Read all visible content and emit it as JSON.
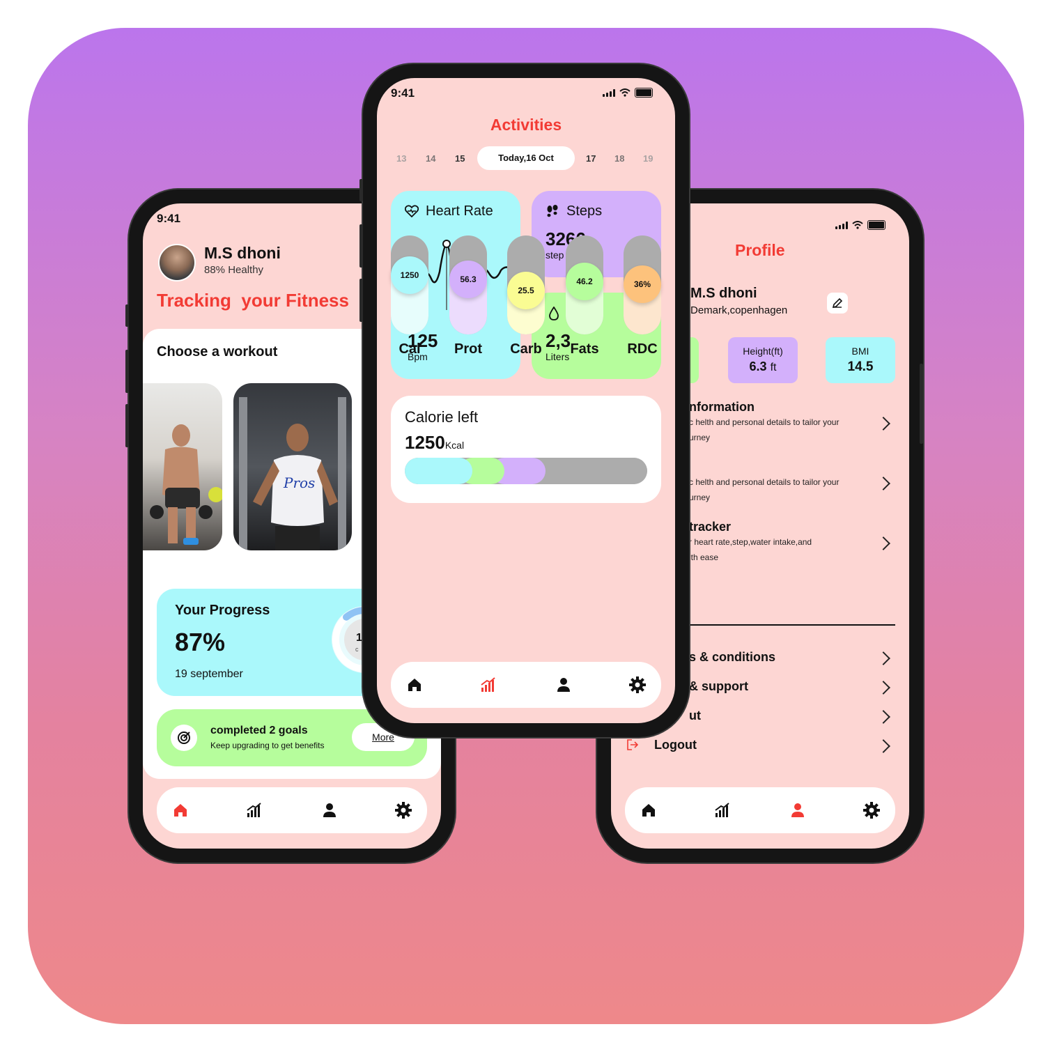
{
  "colors": {
    "accent_red": "#f23b34",
    "screen_bg": "#fdd6d3",
    "cyan": "#aaf8fb",
    "purple": "#d3b0fb",
    "green": "#b6fd9c",
    "yellow": "#fafc93",
    "orange": "#fdc27c",
    "gray": "#acacac"
  },
  "left_phone": {
    "time": "9:41",
    "user_name": "M.S dhoni",
    "health": "88% Healthy",
    "headline": "Tracking  your Fitness",
    "choose_title": "Choose a workout",
    "progress": {
      "title": "Your Progress",
      "percent": "87%",
      "date": "19 september",
      "ring_text": "1",
      "ring_sub": "c",
      "ring_fraction": 0.87
    },
    "goals": {
      "title": "completed 2 goals",
      "subtitle": "Keep upgrading to get benefits",
      "more": "More"
    },
    "nav": {
      "active": "home",
      "icons": [
        "home-icon",
        "stats-icon",
        "profile-icon",
        "settings-icon"
      ]
    }
  },
  "center_phone": {
    "time": "9:41",
    "title": "Activities",
    "dates": [
      "13",
      "14",
      "15",
      "Today,16 Oct",
      "17",
      "18",
      "19"
    ],
    "heart_rate": {
      "label": "Heart Rate",
      "value": "125",
      "unit": "Bpm"
    },
    "steps": {
      "label": "Steps",
      "value": "3266",
      "unit": "step"
    },
    "water": {
      "label": "water",
      "value": "2,3",
      "unit": "Liters"
    },
    "calorie": {
      "label": "Calorie left",
      "value": "1250",
      "unit": "Kcal",
      "segments": [
        {
          "color": "#aaf8fb",
          "fraction": 0.28
        },
        {
          "color": "#b6fd9c",
          "fraction": 0.13
        },
        {
          "color": "#d3b0fb",
          "fraction": 0.17
        },
        {
          "color": "#acacac",
          "fraction": 0.42
        }
      ]
    },
    "macros": [
      {
        "label": "Cal",
        "value": "1250",
        "level": 0.66,
        "color": "#aaf8fb",
        "light": "#e7fdfc"
      },
      {
        "label": "Prot",
        "value": "56.3",
        "level": 0.59,
        "color": "#d3b0fb",
        "light": "#ecdcfd"
      },
      {
        "label": "Carb",
        "value": "25.5",
        "level": 0.41,
        "color": "#fafc93",
        "light": "#fdfdd0"
      },
      {
        "label": "Fats",
        "value": "46.2",
        "level": 0.56,
        "color": "#b6fd9c",
        "light": "#e2fed6"
      },
      {
        "label": "RDC",
        "value": "36%",
        "level": 0.51,
        "color": "#fdc27c",
        "light": "#fde6ce"
      }
    ],
    "nav": {
      "active": "stats",
      "icons": [
        "home-icon",
        "stats-icon",
        "profile-icon",
        "settings-icon"
      ]
    }
  },
  "right_phone": {
    "title": "Profile",
    "user_name": "M.S dhoni",
    "location": "Demark,copenhagen",
    "stats": [
      {
        "label": "Height(ft)",
        "value": "6.3",
        "unit": "ft"
      },
      {
        "label": "BMI",
        "value": "14.5",
        "unit": ""
      }
    ],
    "sections": [
      {
        "title": "nformation",
        "desc_1": "c helth and personal details to tailor your",
        "desc_2": "urney"
      },
      {
        "title": "",
        "desc_1": "c helth and personal details to tailor your",
        "desc_2": "urney"
      },
      {
        "title": "tracker",
        "desc_1": "r heart rate,step,water intake,and",
        "desc_2": "ith ease"
      }
    ],
    "links": [
      "s & conditions",
      "& support",
      "ut",
      "Logout"
    ],
    "nav": {
      "active": "profile",
      "icons": [
        "home-icon",
        "stats-icon",
        "profile-icon",
        "settings-icon"
      ]
    }
  }
}
